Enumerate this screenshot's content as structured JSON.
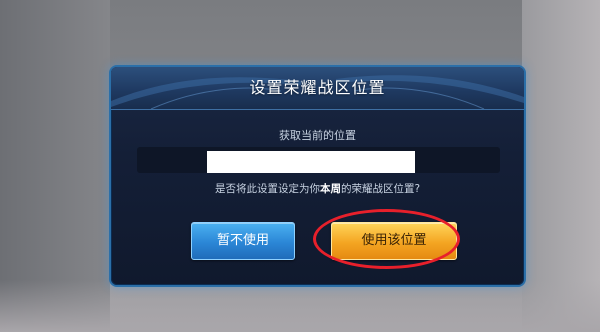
{
  "dialog": {
    "title": "设置荣耀战区位置",
    "subtitle": "获取当前的位置",
    "location_value": "",
    "question_prefix": "是否将此设置设定为你",
    "question_highlight": "本周",
    "question_suffix": "的荣耀战区位置?"
  },
  "buttons": {
    "later_label": "暂不使用",
    "use_label": "使用该位置"
  },
  "colors": {
    "accent_blue": "#2b86d6",
    "accent_orange": "#f4a522",
    "annotation_red": "#e8202b",
    "dialog_bg": "#141f37"
  }
}
